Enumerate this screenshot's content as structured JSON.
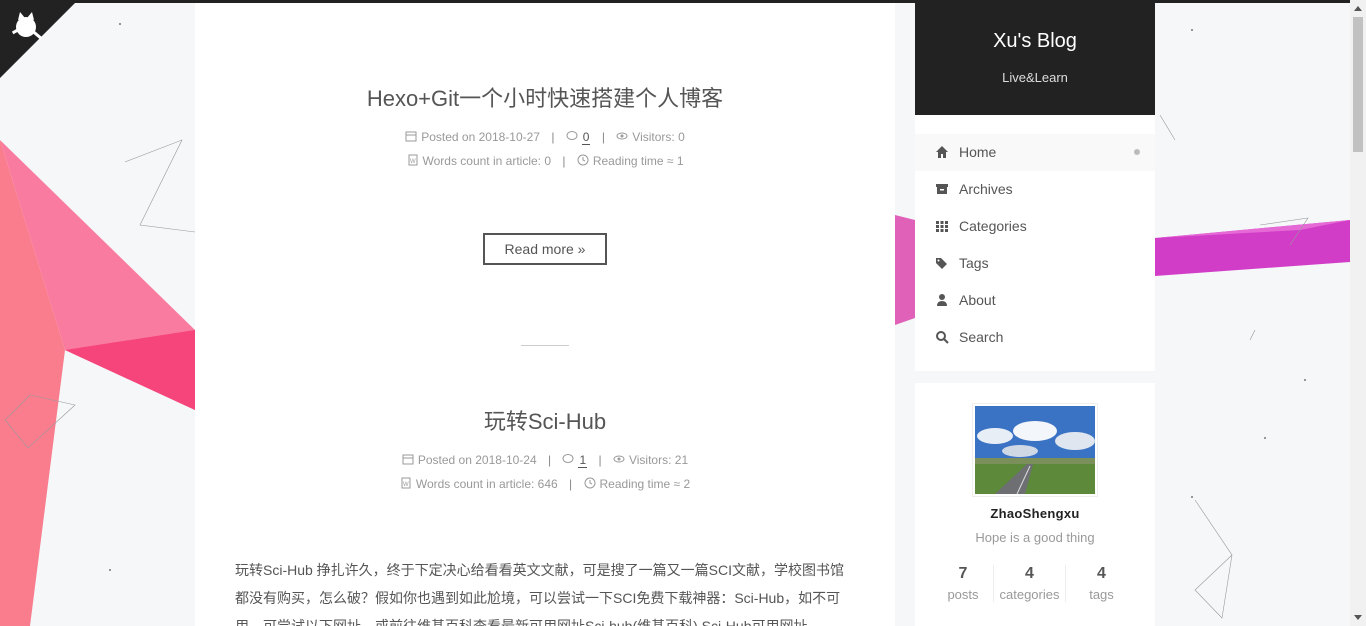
{
  "brand": {
    "title": "Xu's Blog",
    "subtitle": "Live&Learn"
  },
  "menu": [
    {
      "label": "Home",
      "icon": "home-icon",
      "active": true
    },
    {
      "label": "Archives",
      "icon": "archive-icon"
    },
    {
      "label": "Categories",
      "icon": "th-icon"
    },
    {
      "label": "Tags",
      "icon": "tags-icon"
    },
    {
      "label": "About",
      "icon": "user-icon"
    },
    {
      "label": "Search",
      "icon": "search-icon"
    }
  ],
  "posts": [
    {
      "title": "Hexo+Git一个小时快速搭建个人博客",
      "posted_label": "Posted on",
      "date": "2018-10-27",
      "comments": "0",
      "visitors_label": "Visitors:",
      "visitors": "0",
      "words_label": "Words count in article:",
      "words": "0",
      "reading_label": "Reading time ≈",
      "reading": "1",
      "read_more": "Read more »"
    },
    {
      "title": "玩转Sci-Hub",
      "posted_label": "Posted on",
      "date": "2018-10-24",
      "comments": "1",
      "visitors_label": "Visitors:",
      "visitors": "21",
      "words_label": "Words count in article:",
      "words": "646",
      "reading_label": "Reading time ≈",
      "reading": "2",
      "excerpt": [
        "玩转Sci-Hub 挣扎许久，终于下定决心给看看英文文献，可是搜了一篇又一篇SCI文献，学校图书馆",
        "都没有购买，怎么破？假如你也遇到如此尬境，可以尝试一下SCI免费下载神器：Sci-Hub，如不可",
        "用，可尝试以下网址，或前往维基百科查看最新可用网址Sci-hub(维基百科) Sci-Hub可用网址 ..."
      ]
    }
  ],
  "author": {
    "name": "ZhaoShengxu",
    "description": "Hope is a good thing"
  },
  "stats": [
    {
      "num": "7",
      "label": "posts"
    },
    {
      "num": "4",
      "label": "categories"
    },
    {
      "num": "4",
      "label": "tags"
    }
  ],
  "colors": {
    "dark": "#222222",
    "accent_pink": "#f7427a",
    "accent_magenta": "#d93fc9"
  }
}
